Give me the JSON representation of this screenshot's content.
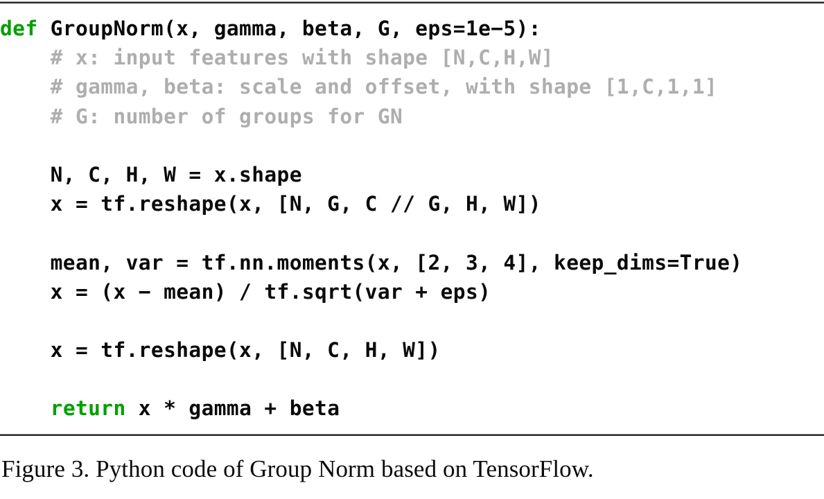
{
  "figure": {
    "caption": "Figure 3. Python code of Group Norm based on TensorFlow.",
    "rules": {
      "top": "horizontal-rule",
      "bottom": "horizontal-rule"
    }
  },
  "colors": {
    "keyword": "#00a000",
    "comment": "#aeaeae",
    "code_text": "#0a0a0a",
    "rule": "#2a2a2a",
    "background": "#ffffff"
  },
  "code": {
    "language": "Python",
    "framework": "TensorFlow",
    "lines": [
      {
        "n": 1,
        "tokens": [
          {
            "t": "kw",
            "s": "def"
          },
          {
            "t": "plain",
            "s": " GroupNorm(x, gamma, beta, G, eps=1e−5):"
          }
        ]
      },
      {
        "n": 2,
        "tokens": [
          {
            "t": "comment",
            "s": "    # x: input features with shape [N,C,H,W]"
          }
        ]
      },
      {
        "n": 3,
        "tokens": [
          {
            "t": "comment",
            "s": "    # gamma, beta: scale and offset, with shape [1,C,1,1]"
          }
        ]
      },
      {
        "n": 4,
        "tokens": [
          {
            "t": "comment",
            "s": "    # G: number of groups for GN"
          }
        ]
      },
      {
        "n": 5,
        "tokens": [
          {
            "t": "plain",
            "s": ""
          }
        ]
      },
      {
        "n": 6,
        "tokens": [
          {
            "t": "plain",
            "s": "    N, C, H, W = x.shape"
          }
        ]
      },
      {
        "n": 7,
        "tokens": [
          {
            "t": "plain",
            "s": "    x = tf.reshape(x, [N, G, C // G, H, W])"
          }
        ]
      },
      {
        "n": 8,
        "tokens": [
          {
            "t": "plain",
            "s": ""
          }
        ]
      },
      {
        "n": 9,
        "tokens": [
          {
            "t": "plain",
            "s": "    mean, var = tf.nn.moments(x, [2, 3, 4], keep_dims=True)"
          }
        ]
      },
      {
        "n": 10,
        "tokens": [
          {
            "t": "plain",
            "s": "    x = (x − mean) / tf.sqrt(var + eps)"
          }
        ]
      },
      {
        "n": 11,
        "tokens": [
          {
            "t": "plain",
            "s": ""
          }
        ]
      },
      {
        "n": 12,
        "tokens": [
          {
            "t": "plain",
            "s": "    x = tf.reshape(x, [N, C, H, W])"
          }
        ]
      },
      {
        "n": 13,
        "tokens": [
          {
            "t": "plain",
            "s": ""
          }
        ]
      },
      {
        "n": 14,
        "tokens": [
          {
            "t": "plain",
            "s": "    "
          },
          {
            "t": "kw",
            "s": "return"
          },
          {
            "t": "plain",
            "s": " x * gamma + beta"
          }
        ]
      }
    ]
  }
}
